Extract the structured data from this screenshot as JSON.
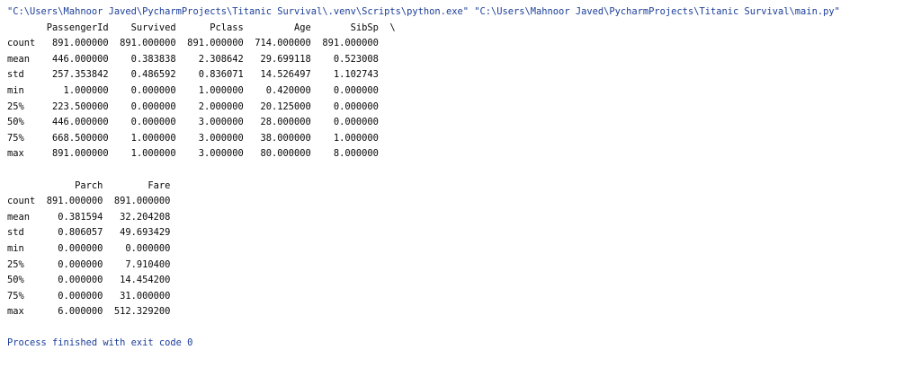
{
  "console": {
    "command": "\"C:\\Users\\Mahnoor Javed\\PycharmProjects\\Titanic Survival\\.venv\\Scripts\\python.exe\" \"C:\\Users\\Mahnoor Javed\\PycharmProjects\\Titanic Survival\\main.py\"",
    "table1": {
      "header": "       PassengerId    Survived      Pclass         Age       SibSp  \\",
      "rows": [
        "count   891.000000  891.000000  891.000000  714.000000  891.000000",
        "mean    446.000000    0.383838    2.308642   29.699118    0.523008",
        "std     257.353842    0.486592    0.836071   14.526497    1.102743",
        "min       1.000000    0.000000    1.000000    0.420000    0.000000",
        "25%     223.500000    0.000000    2.000000   20.125000    0.000000",
        "50%     446.000000    0.000000    3.000000   28.000000    0.000000",
        "75%     668.500000    1.000000    3.000000   38.000000    1.000000",
        "max     891.000000    1.000000    3.000000   80.000000    8.000000"
      ]
    },
    "table2": {
      "header": "            Parch        Fare",
      "rows": [
        "count  891.000000  891.000000",
        "mean     0.381594   32.204208",
        "std      0.806057   49.693429",
        "min      0.000000    0.000000",
        "25%      0.000000    7.910400",
        "50%      0.000000   14.454200",
        "75%      0.000000   31.000000",
        "max      6.000000  512.329200"
      ]
    },
    "exit_message": "Process finished with exit code 0"
  }
}
